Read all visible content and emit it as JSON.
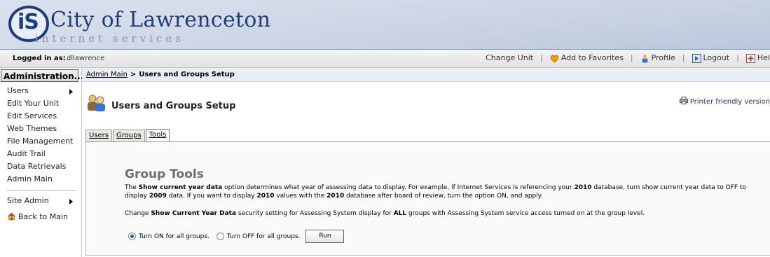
{
  "header": {
    "logo_letters": "iS",
    "city_name": "City of Lawrenceton",
    "sub_name": "internet services"
  },
  "loginbar": {
    "label": "Logged in as:",
    "user": "dllawrence",
    "nav": {
      "change_unit": "Change Unit",
      "add_favorites": "Add to Favorites",
      "profile": "Profile",
      "logout": "Logout",
      "help": "Hel"
    }
  },
  "sidebar": {
    "heading": "Administration...",
    "items": [
      {
        "label": "Users",
        "has_submenu": true
      },
      {
        "label": "Edit Your Unit"
      },
      {
        "label": "Edit Services"
      },
      {
        "label": "Web Themes"
      },
      {
        "label": "File Management"
      },
      {
        "label": "Audit Trail"
      },
      {
        "label": "Data Retrievals"
      },
      {
        "label": "Admin Main"
      },
      {
        "label": "Site Admin",
        "has_submenu": true
      },
      {
        "label": "Back to Main"
      }
    ]
  },
  "breadcrumb": {
    "root": "Admin Main",
    "separator": ">",
    "current": "Users and Groups Setup"
  },
  "page": {
    "title": "Users and Groups Setup",
    "printer_link": "Printer friendly version"
  },
  "tabs": [
    {
      "label": "Users",
      "active": false
    },
    {
      "label": "Groups",
      "active": false
    },
    {
      "label": "Tools",
      "active": true
    }
  ],
  "tools": {
    "title": "Group Tools",
    "desc": {
      "t1": "The ",
      "b1": "Show current year data",
      "t2": " option determines what year of assessing data to display. For example, if Internet Services is referencing your ",
      "b2": "2010",
      "t3": " database, turn show current year data to OFF to display ",
      "b3": "2009",
      "t4": " data. If you want to display ",
      "b4": "2010",
      "t5": " values with the ",
      "b5": "2010",
      "t6": " database after board of review, turn the option ON, and apply."
    },
    "change": {
      "t1": "Change ",
      "b1": "Show Current Year Data",
      "t2": " security setting for Assessing System display for ",
      "b2": "ALL",
      "t3": " groups with Assessing System service access turned on at the group level."
    },
    "option_on": "Turn ON for all groups.",
    "option_off": "Turn OFF for all groups.",
    "selected": "on",
    "run_label": "Run"
  },
  "colors": {
    "brand": "#1f3f7a",
    "header_bg": "#c3cde0",
    "breadcrumb_bg": "#e9eef6"
  }
}
